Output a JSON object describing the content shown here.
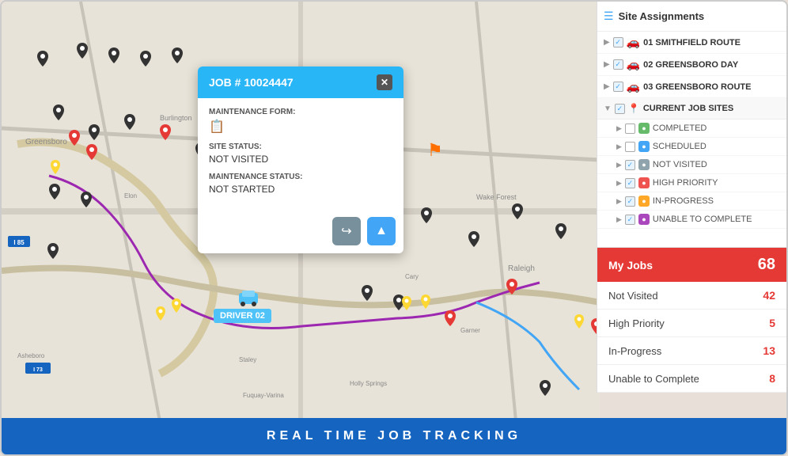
{
  "panel": {
    "header": {
      "icon": "☰",
      "title": "Site Assignments"
    },
    "routes": [
      {
        "label": "01 SMITHFIELD ROUTE",
        "checked": true
      },
      {
        "label": "02 GREENSBORO DAY",
        "checked": true
      },
      {
        "label": "03 GREENSBORO ROUTE",
        "checked": true
      }
    ],
    "current_sites_title": "CURRENT JOB SITES",
    "site_statuses": [
      {
        "label": "COMPLETED",
        "checked": false,
        "color": "green"
      },
      {
        "label": "SCHEDULED",
        "checked": false,
        "color": "blue"
      },
      {
        "label": "NOT VISITED",
        "checked": true,
        "color": "gray"
      },
      {
        "label": "HIGH PRIORITY",
        "checked": true,
        "color": "red"
      },
      {
        "label": "IN-PROGRESS",
        "checked": true,
        "color": "orange"
      },
      {
        "label": "UNABLE TO COMPLETE",
        "checked": true,
        "color": "purple"
      }
    ]
  },
  "stats": {
    "title": "My Jobs",
    "count": 68,
    "rows": [
      {
        "label": "Not Visited",
        "value": 42
      },
      {
        "label": "High Priority",
        "value": 5
      },
      {
        "label": "In-Progress",
        "value": 13
      },
      {
        "label": "Unable to Complete",
        "value": 8
      }
    ]
  },
  "popup": {
    "job_number": "JOB # 10024447",
    "maintenance_form_label": "MAINTENANCE FORM:",
    "site_status_label": "SITE STATUS:",
    "site_status_value": "NOT VISITED",
    "maintenance_status_label": "MAINTENANCE STATUS:",
    "maintenance_status_value": "NOT STARTED"
  },
  "driver": {
    "label": "DRIVER 02"
  },
  "banner": {
    "text": "REAL TIME JOB TRACKING"
  }
}
